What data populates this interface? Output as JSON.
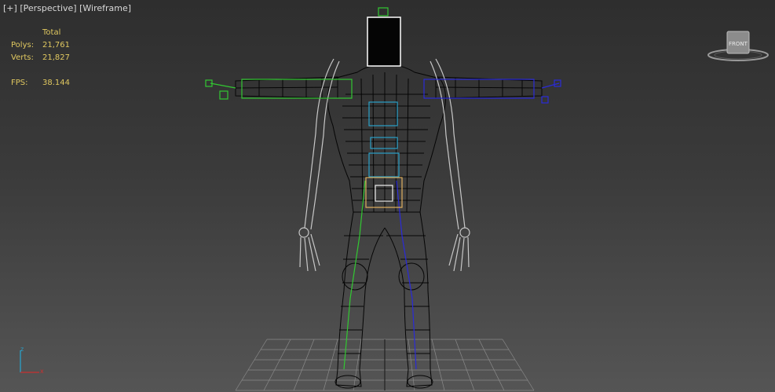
{
  "viewport": {
    "menu_label": "[+]",
    "view_label": "[Perspective]",
    "shading_label": "[Wireframe]"
  },
  "stats": {
    "header": "Total",
    "polys_label": "Polys:",
    "polys_value": "21,761",
    "verts_label": "Verts:",
    "verts_value": "21,827",
    "fps_label": "FPS:",
    "fps_value": "38.144"
  },
  "viewcube": {
    "face_label": "FRONT"
  },
  "axis": {
    "z_label": "z",
    "x_label": "x"
  },
  "colors": {
    "left_rig": "#32c832",
    "right_rig": "#2a2ad8",
    "spine_rig": "#2aa0c8",
    "pelvis_rig": "#e0b060",
    "head_box": "#ffffff",
    "mesh": "#050505",
    "bone": "#c8c8c8"
  }
}
